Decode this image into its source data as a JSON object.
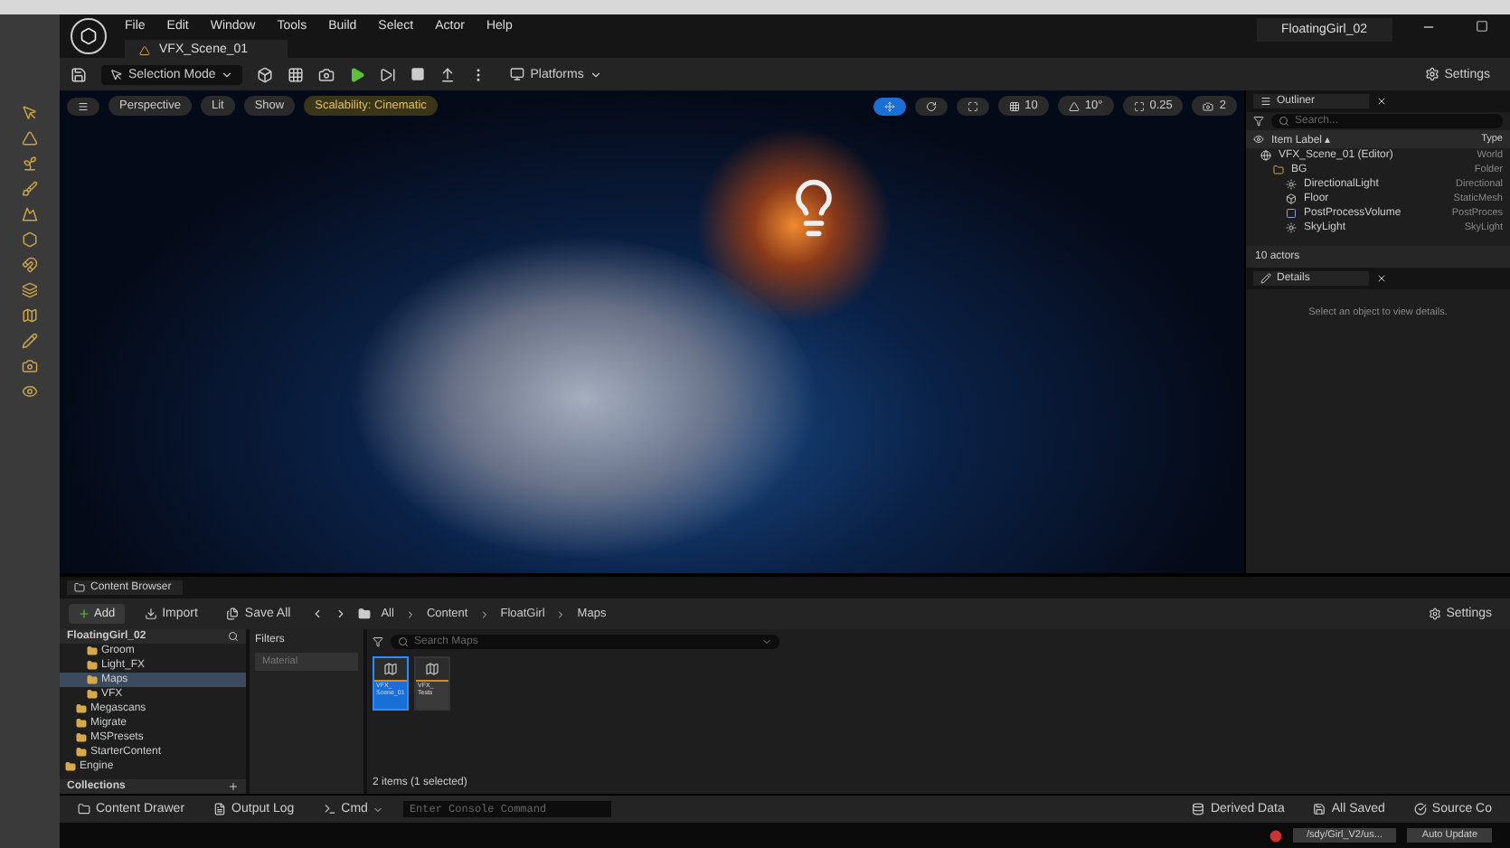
{
  "menu": {
    "items": [
      "File",
      "Edit",
      "Window",
      "Tools",
      "Build",
      "Select",
      "Actor",
      "Help"
    ],
    "project": "FloatingGirl_02"
  },
  "level_tab": {
    "label": "VFX_Scene_01"
  },
  "toolbar": {
    "mode": "Selection Mode",
    "platforms": "Platforms",
    "settings": "Settings"
  },
  "viewport": {
    "buttons": [
      "Perspective",
      "Lit",
      "Show"
    ],
    "scalability": "Scalability: Cinematic",
    "grid": "10",
    "angle": "10°",
    "scale": "0.25",
    "camera": "2"
  },
  "outliner": {
    "title": "Outliner",
    "search": {
      "placeholder": "Search..."
    },
    "columns": [
      "Item Label ▴",
      "Type"
    ],
    "tree": [
      {
        "label": "VFX_Scene_01 (Editor)",
        "type": "World",
        "kind": "world",
        "children": [
          {
            "label": "BG",
            "type": "Folder",
            "kind": "folder",
            "children": [
              {
                "label": "DirectionalLight",
                "type": "Directional",
                "kind": "light"
              },
              {
                "label": "Floor",
                "type": "StaticMesh",
                "kind": "mesh"
              },
              {
                "label": "PostProcessVolume",
                "type": "PostProces",
                "kind": "volume"
              },
              {
                "label": "SkyLight",
                "type": "SkyLight",
                "kind": "light"
              }
            ]
          }
        ]
      }
    ],
    "count": "10 actors"
  },
  "details": {
    "title": "Details",
    "hint": "Select an object to view details."
  },
  "content_browser": {
    "title": "Content Browser",
    "add": "Add",
    "import": "Import",
    "save_all": "Save All",
    "breadcrumb": [
      "All",
      "Content",
      "FloatGirl",
      "Maps"
    ],
    "settings": "Settings",
    "root": "FloatingGirl_02",
    "tree": [
      {
        "children": [
          {
            "children": [
              {
                "label": "Groom",
                "selected": false
              },
              {
                "label": "Light_FX",
                "selected": false
              },
              {
                "label": "Maps",
                "selected": true
              },
              {
                "label": "VFX",
                "selected": false
              }
            ]
          },
          {
            "label": "Megascans",
            "selected": false
          },
          {
            "label": "Migrate",
            "selected": false
          },
          {
            "label": "MSPresets",
            "selected": false
          },
          {
            "label": "StarterContent",
            "selected": false
          }
        ]
      },
      {
        "label": "Engine",
        "selected": false
      }
    ],
    "collections": "Collections",
    "filters": "Filters",
    "filter_chip": "Material",
    "search": {
      "placeholder": "Search Maps"
    },
    "assets": [
      {
        "label": "VFX_ Scene_01",
        "selected": true
      },
      {
        "label": "VFX_ Tests",
        "selected": false
      }
    ],
    "status": "2 items (1 selected)"
  },
  "bottom_bar": {
    "content_drawer": "Content Drawer",
    "output_log": "Output Log",
    "cmd": "Cmd",
    "console": {
      "placeholder": "Enter Console Command"
    },
    "derived_data": "Derived Data",
    "all_saved": "All Saved",
    "source_control": "Source Co"
  },
  "host_bar": {
    "path": "/sdy/Girl_V2/us...",
    "auto_update": "Auto Update"
  }
}
